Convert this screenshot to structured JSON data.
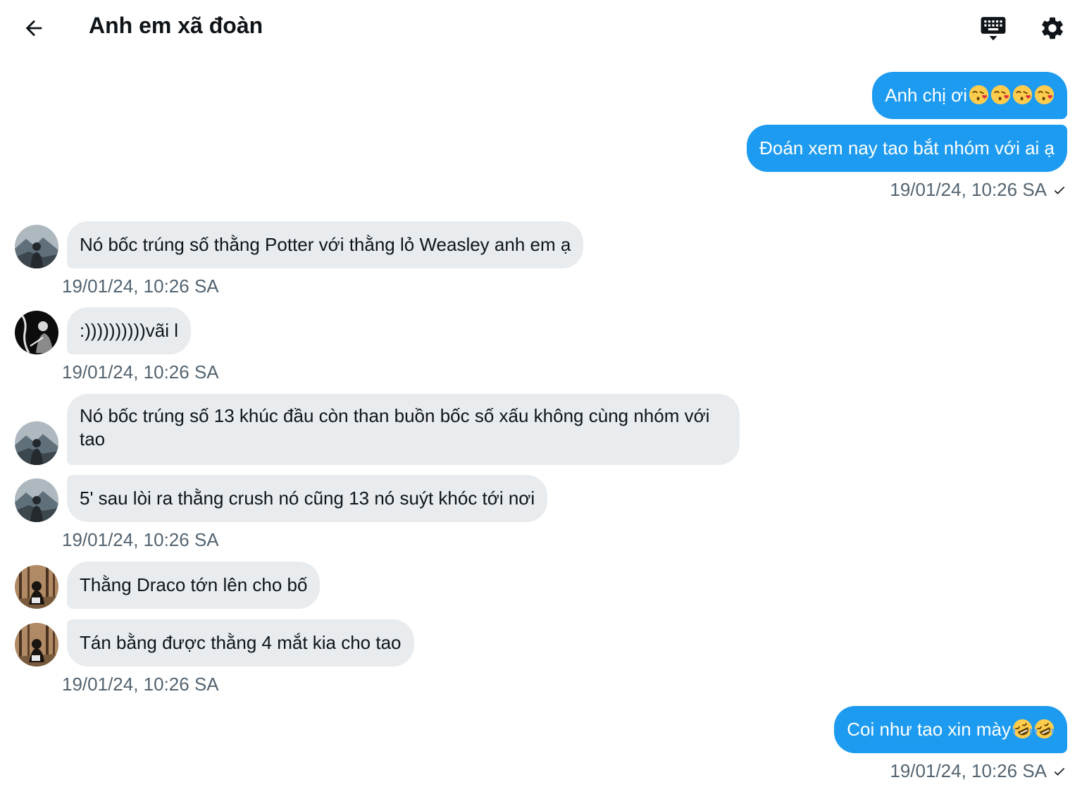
{
  "header": {
    "title": "Anh em xã đoàn"
  },
  "messages": [
    {
      "direction": "out",
      "text": "Anh chị ơi",
      "emoji": [
        "kissing-heart",
        "kissing-heart",
        "kissing-heart",
        "kissing-heart"
      ]
    },
    {
      "direction": "out",
      "text": "Đoán xem nay tao bắt nhóm với ai ạ"
    },
    {
      "meta": "19/01/24, 10:26 SA",
      "status": "sent"
    },
    {
      "direction": "in",
      "avatar": "mountain",
      "text": "Nó bốc trúng số thằng Potter với thằng lỏ Weasley anh em ạ"
    },
    {
      "meta": "19/01/24, 10:26 SA"
    },
    {
      "direction": "in",
      "avatar": "dark",
      "text": ":))))))))))vãi l"
    },
    {
      "meta": "19/01/24, 10:26 SA"
    },
    {
      "direction": "in",
      "avatar": "mountain",
      "text": "Nó bốc trúng số 13 khúc đầu còn than buồn bốc số xấu không cùng nhóm với tao"
    },
    {
      "direction": "in",
      "avatar": "mountain",
      "text": "5' sau lòi ra thằng crush nó cũng 13 nó suýt khóc tới nơi"
    },
    {
      "meta": "19/01/24, 10:26 SA"
    },
    {
      "direction": "in",
      "avatar": "forest",
      "text": "Thằng Draco tớn lên cho bố"
    },
    {
      "direction": "in",
      "avatar": "forest",
      "text": "Tán bằng được thằng 4 mắt kia cho tao"
    },
    {
      "meta": "19/01/24, 10:26 SA"
    },
    {
      "direction": "out",
      "text": "Coi như tao xin mày",
      "emoji": [
        "rolling-laughing",
        "rolling-laughing"
      ]
    },
    {
      "meta": "19/01/24, 10:26 SA",
      "status": "sent"
    }
  ],
  "colors": {
    "outgoing_bubble": "#1d9bf0",
    "incoming_bubble": "#e8ecef",
    "timestamp": "#536471"
  }
}
